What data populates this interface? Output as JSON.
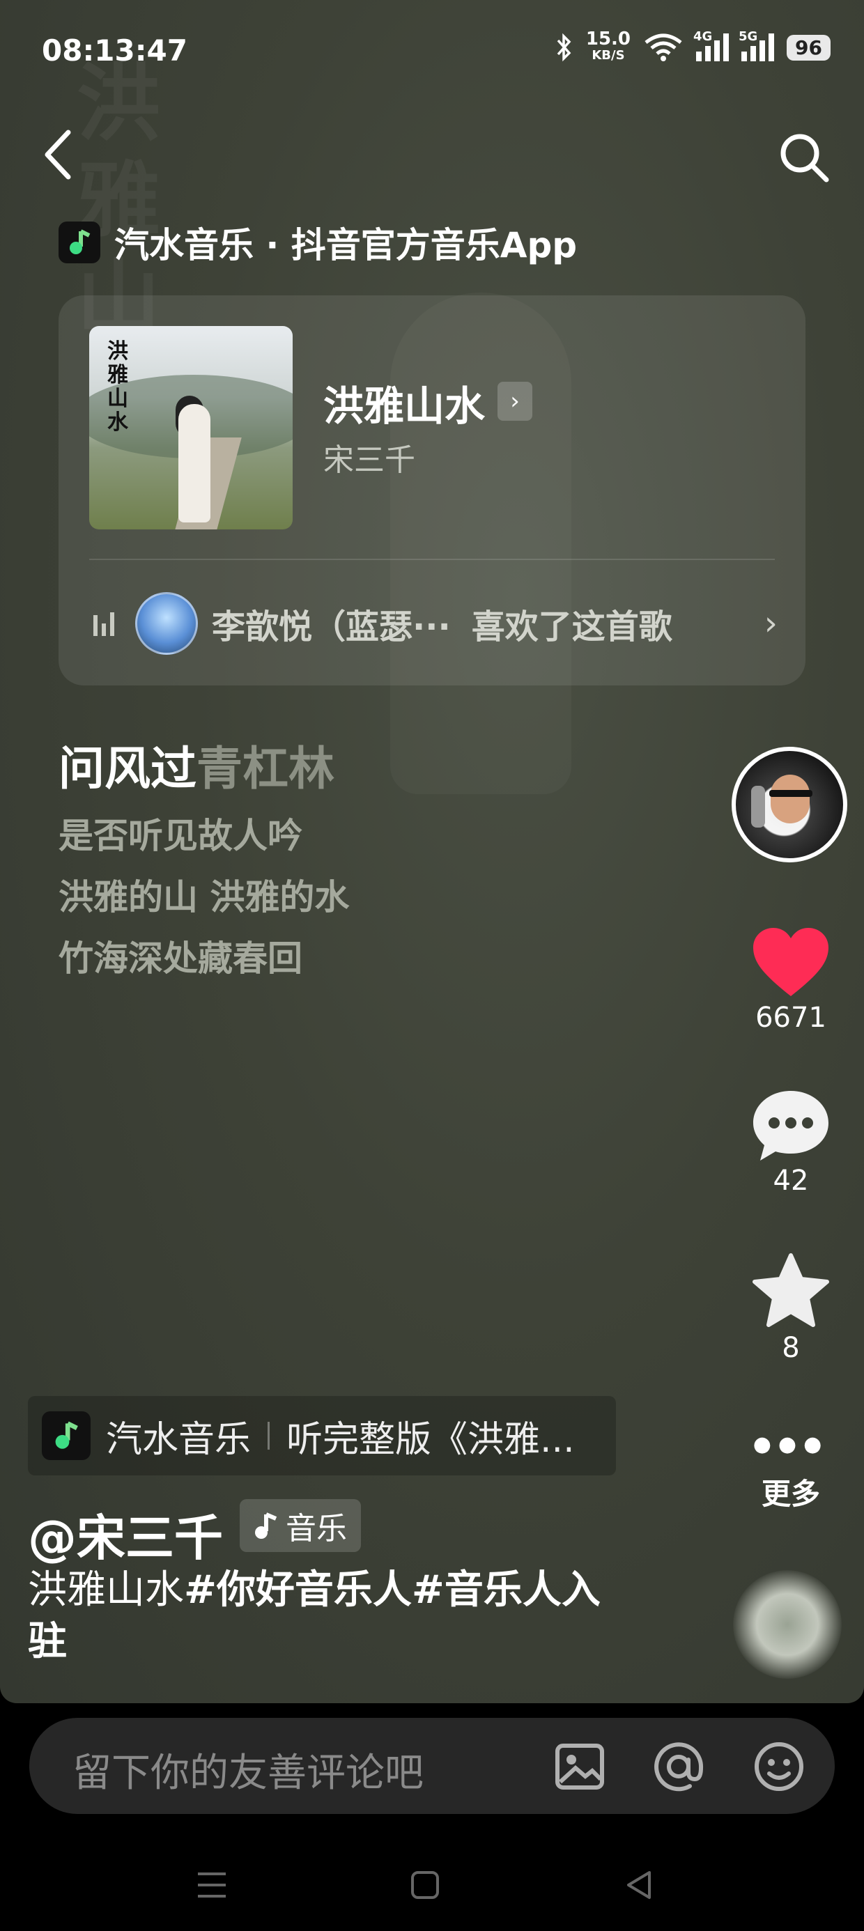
{
  "status_bar": {
    "time": "08:13:47",
    "speed_value": "15.0",
    "speed_unit": "KB/S",
    "net1": "4G",
    "net2": "5G",
    "battery": "96"
  },
  "header": {
    "app_source": "汽水音乐 · 抖音官方音乐App"
  },
  "song_card": {
    "cover_text": "洪雅山水",
    "title": "洪雅山水",
    "artist": "宋三千",
    "liker_name": "李歆悦（蓝瑟···",
    "liked_text": "喜欢了这首歌"
  },
  "lyrics": {
    "current_sung": "问风过",
    "current_rest": "青杠林",
    "lines": [
      "是否听见故人吟",
      "洪雅的山 洪雅的水",
      "竹海深处藏春回"
    ]
  },
  "rail": {
    "likes": "6671",
    "comments": "42",
    "favorites": "8",
    "more_label": "更多"
  },
  "promo": {
    "app_name": "汽水音乐",
    "text": "听完整版《洪雅..."
  },
  "post": {
    "handle": "@宋三千",
    "tag_label": "音乐",
    "desc_plain": "洪雅山水",
    "desc_tag1": "#你好音乐人",
    "desc_tag2": "#音乐人入驻"
  },
  "comment_bar": {
    "placeholder": "留下你的友善评论吧"
  },
  "colors": {
    "heart": "#fe2c55",
    "app_accent": "#3ddc84",
    "background": "#3c4036"
  }
}
